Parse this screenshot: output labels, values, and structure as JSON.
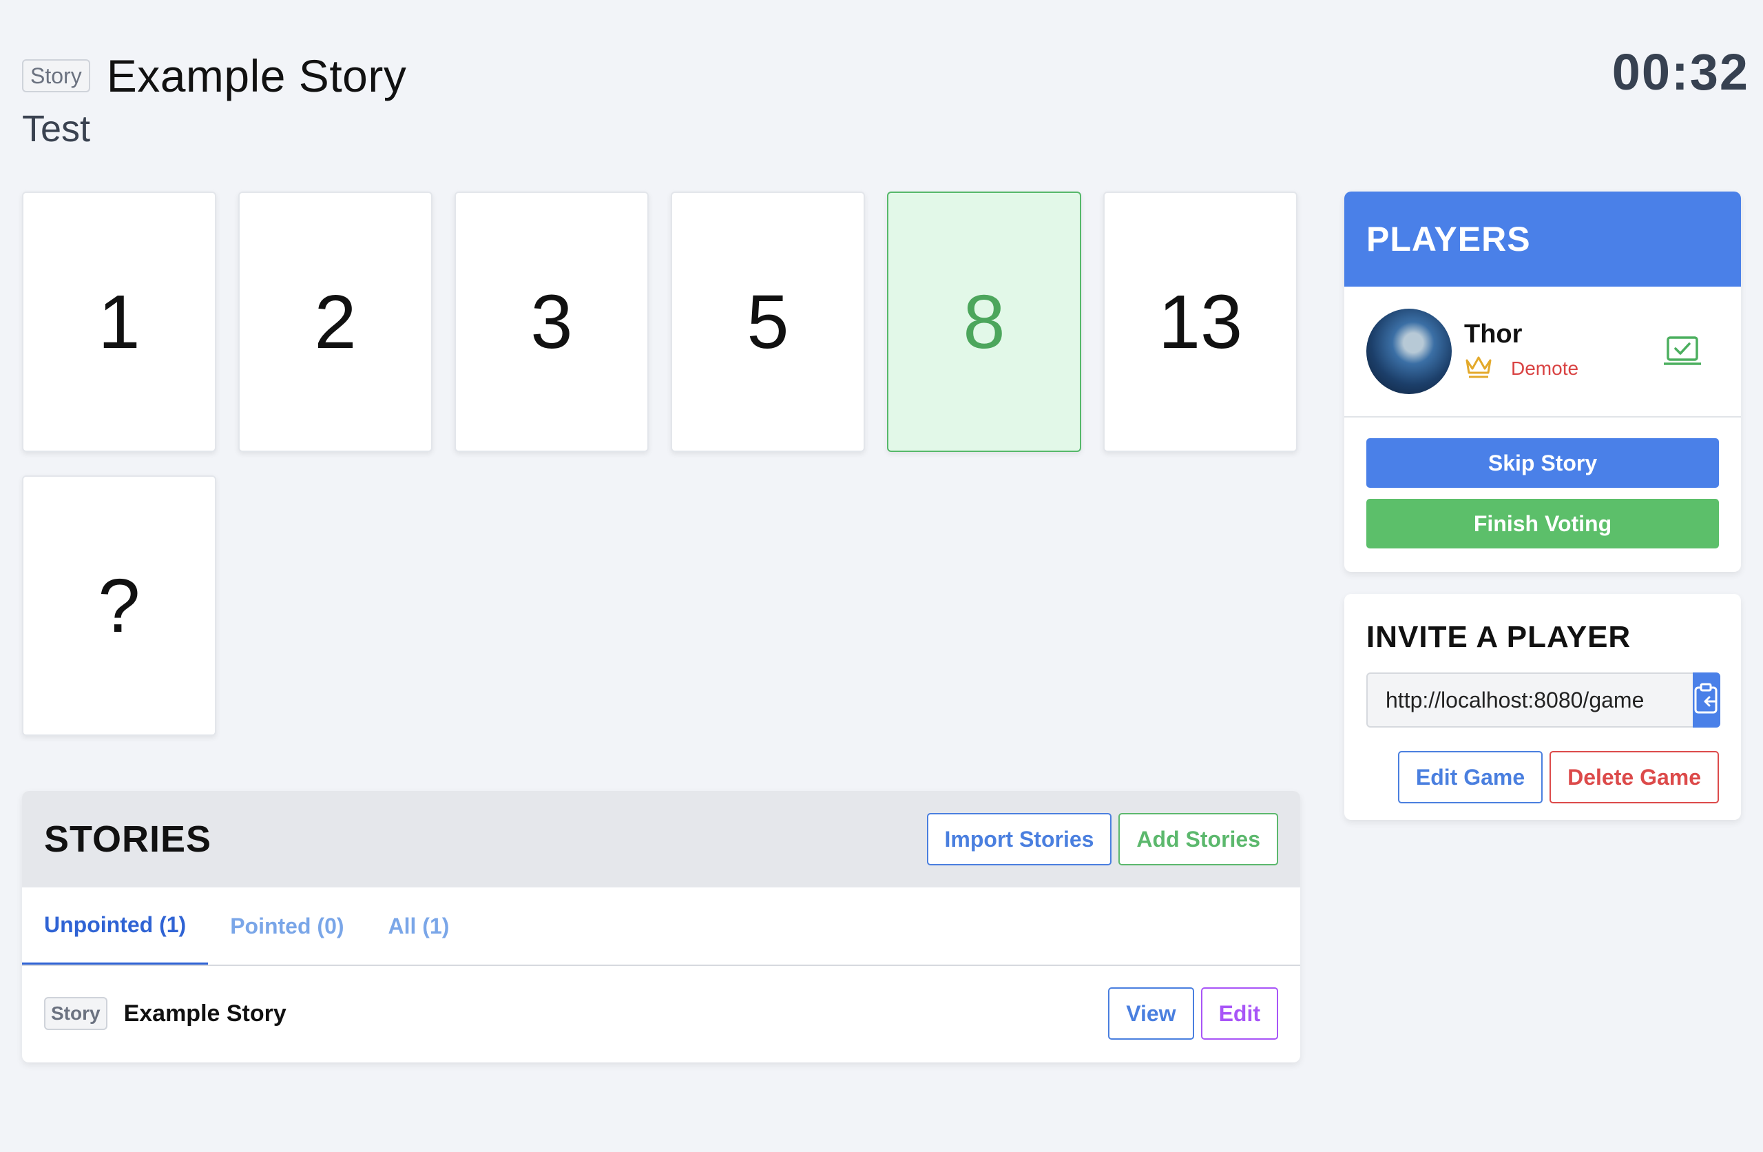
{
  "header": {
    "type_badge": "Story",
    "title": "Example Story",
    "description": "Test",
    "timer": "00:32"
  },
  "cards": [
    {
      "value": "1",
      "selected": false
    },
    {
      "value": "2",
      "selected": false
    },
    {
      "value": "3",
      "selected": false
    },
    {
      "value": "5",
      "selected": false
    },
    {
      "value": "8",
      "selected": true
    },
    {
      "value": "13",
      "selected": false
    },
    {
      "value": "?",
      "selected": false
    }
  ],
  "stories": {
    "title": "STORIES",
    "import_label": "Import Stories",
    "add_label": "Add Stories",
    "tabs": [
      {
        "label": "Unpointed (1)",
        "active": true
      },
      {
        "label": "Pointed (0)",
        "active": false
      },
      {
        "label": "All (1)",
        "active": false
      }
    ],
    "rows": [
      {
        "badge": "Story",
        "title": "Example Story",
        "view_label": "View",
        "edit_label": "Edit"
      }
    ]
  },
  "players": {
    "title": "PLAYERS",
    "list": [
      {
        "name": "Thor",
        "role_icon": "crown-icon",
        "demote_label": "Demote",
        "status_icon": "voted-check-icon"
      }
    ],
    "skip_label": "Skip Story",
    "finish_label": "Finish Voting"
  },
  "invite": {
    "title": "INVITE A PLAYER",
    "link_value": "http://localhost:8080/game",
    "copy_icon": "clipboard-copy-icon",
    "edit_label": "Edit Game",
    "delete_label": "Delete Game"
  },
  "colors": {
    "primary": "#4a80e8",
    "success": "#5cbf6a",
    "danger": "#dc4a4a",
    "selected_card_bg": "#e2f8e8",
    "background": "#f2f4f8"
  }
}
